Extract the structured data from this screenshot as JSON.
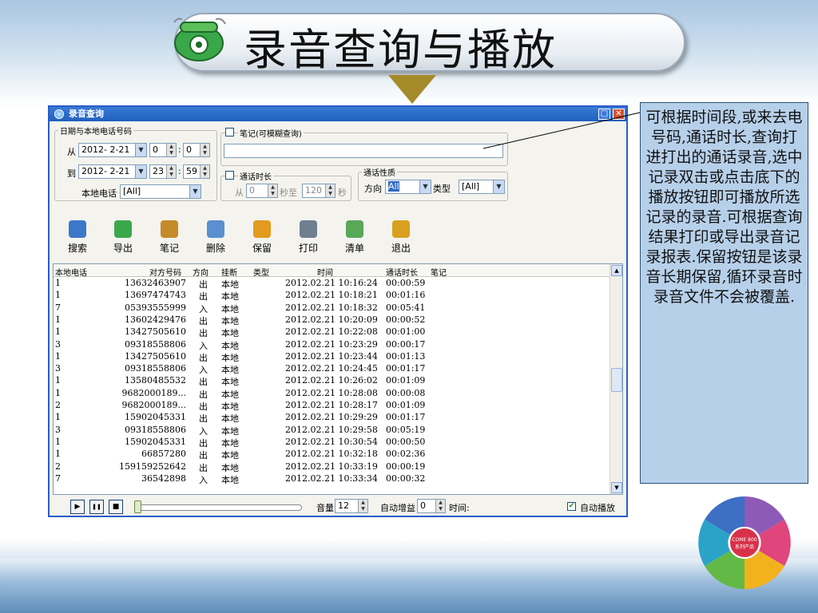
{
  "slide": {
    "title": "录音查询与播放",
    "note": "可根据时间段,或来去电号码,通话时长,查询打进打出的通话录音,选中记录双击或点击底下的播放按钮即可播放所选记录的录音.可根据查询结果打印或导出录音记录报表.保留按钮是该录音长期保留,循环录音时录音文件不会被覆盖.",
    "logo": {
      "center_line1": "COME 800",
      "center_line2": "系列产品"
    }
  },
  "window": {
    "title": "录音查询",
    "restore_glyph": "□",
    "close_glyph": "✕",
    "filters": {
      "date_group_label": "日期与本地电话号码",
      "from_label": "从",
      "from_date": "2012- 2-21",
      "from_hour": "0",
      "from_minute": "0",
      "to_label": "到",
      "to_date": "2012- 2-21",
      "to_hour": "23",
      "to_minute": "59",
      "time_sep": ":",
      "local_phone_label": "本地电话",
      "local_phone_value": "[All]",
      "notes_label": "笔记(可模糊查询)",
      "notes_value": "",
      "duration_label": "通话时长",
      "duration_from_label": "从",
      "duration_from": "0",
      "sec_to_label": "秒至",
      "duration_to": "120",
      "sec_label": "秒",
      "nature_group_label": "通话性质",
      "direction_label": "方向",
      "direction_value": "All",
      "type_label": "类型",
      "type_value": "[All]"
    },
    "toolbar": [
      {
        "label": "搜索",
        "icon": "search-icon",
        "color": "#3c78c8"
      },
      {
        "label": "导出",
        "icon": "export-icon",
        "color": "#3aa84a"
      },
      {
        "label": "笔记",
        "icon": "note-icon",
        "color": "#c58a2a"
      },
      {
        "label": "删除",
        "icon": "delete-icon",
        "color": "#5a8fd0"
      },
      {
        "label": "保留",
        "icon": "keep-icon",
        "color": "#e39a1e"
      },
      {
        "label": "打印",
        "icon": "print-icon",
        "color": "#6f7f8f"
      },
      {
        "label": "清单",
        "icon": "list-icon",
        "color": "#58a858"
      },
      {
        "label": "退出",
        "icon": "exit-icon",
        "color": "#d8a020"
      }
    ],
    "table": {
      "columns": [
        "本地电话",
        "对方号码",
        "方向",
        "挂断",
        "类型",
        "时间",
        "通话时长",
        "笔记"
      ],
      "rows": [
        [
          "1",
          "13632463907",
          "出",
          "本地",
          "",
          "2012.02.21 10:16:24",
          "00:00:59",
          ""
        ],
        [
          "1",
          "13697474743",
          "出",
          "本地",
          "",
          "2012.02.21 10:18:21",
          "00:01:16",
          ""
        ],
        [
          "7",
          "05393555999",
          "入",
          "本地",
          "",
          "2012.02.21 10:18:32",
          "00:05:41",
          ""
        ],
        [
          "1",
          "13602429476",
          "出",
          "本地",
          "",
          "2012.02.21 10:20:09",
          "00:00:52",
          ""
        ],
        [
          "1",
          "13427505610",
          "出",
          "本地",
          "",
          "2012.02.21 10:22:08",
          "00:01:00",
          ""
        ],
        [
          "3",
          "09318558806",
          "入",
          "本地",
          "",
          "2012.02.21 10:23:29",
          "00:00:17",
          ""
        ],
        [
          "1",
          "13427505610",
          "出",
          "本地",
          "",
          "2012.02.21 10:23:44",
          "00:01:13",
          ""
        ],
        [
          "3",
          "09318558806",
          "入",
          "本地",
          "",
          "2012.02.21 10:24:45",
          "00:01:17",
          ""
        ],
        [
          "1",
          "13580485532",
          "出",
          "本地",
          "",
          "2012.02.21 10:26:02",
          "00:01:09",
          ""
        ],
        [
          "1",
          "9682000189...",
          "出",
          "本地",
          "",
          "2012.02.21 10:28:08",
          "00:00:08",
          ""
        ],
        [
          "2",
          "9682000189...",
          "出",
          "本地",
          "",
          "2012.02.21 10:28:17",
          "00:01:09",
          ""
        ],
        [
          "1",
          "15902045331",
          "出",
          "本地",
          "",
          "2012.02.21 10:29:29",
          "00:01:17",
          ""
        ],
        [
          "3",
          "09318558806",
          "入",
          "本地",
          "",
          "2012.02.21 10:29:58",
          "00:05:19",
          ""
        ],
        [
          "1",
          "15902045331",
          "出",
          "本地",
          "",
          "2012.02.21 10:30:54",
          "00:00:50",
          ""
        ],
        [
          "1",
          "66857280",
          "出",
          "本地",
          "",
          "2012.02.21 10:32:18",
          "00:02:36",
          ""
        ],
        [
          "2",
          "159159252642",
          "出",
          "本地",
          "",
          "2012.02.21 10:33:19",
          "00:00:19",
          ""
        ],
        [
          "7",
          "36542898",
          "入",
          "本地",
          "",
          "2012.02.21 10:33:34",
          "00:00:32",
          ""
        ]
      ]
    },
    "player": {
      "play_glyph": "▶",
      "pause_glyph": "❚❚",
      "stop_glyph": "■",
      "volume_label": "音量",
      "volume_value": "12",
      "gain_label": "自动增益",
      "gain_value": "0",
      "time_label": "时间:",
      "autoplay_label": "自动播放",
      "autoplay_checked": true,
      "progress": 0
    }
  }
}
